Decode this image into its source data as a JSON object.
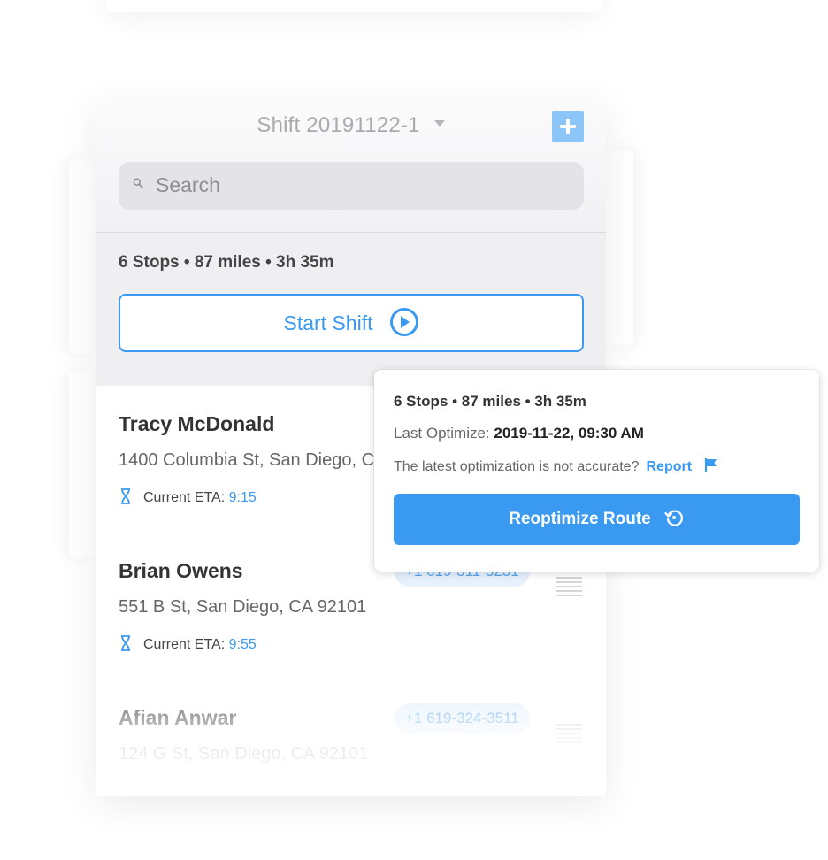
{
  "header": {
    "shift_title": "Shift 20191122-1",
    "search_placeholder": "Search"
  },
  "summary": {
    "text": "6 Stops • 87 miles • 3h 35m",
    "start_button": "Start Shift"
  },
  "stops": [
    {
      "name": "Tracy McDonald",
      "address": "1400 Columbia St, San Diego, C",
      "eta_label": "Current ETA:",
      "eta_value": "9:15"
    },
    {
      "name": "Brian Owens",
      "address": "551 B St, San Diego, CA 92101",
      "phone": "+1 619-311-3231",
      "eta_label": "Current ETA:",
      "eta_value": "9:55"
    },
    {
      "name": "Afian Anwar",
      "address": "124 G St, San Diego, CA 92101",
      "phone": "+1 619-324-3511"
    }
  ],
  "popover": {
    "summary": "6 Stops • 87 miles • 3h 35m",
    "last_optimize_label": "Last Optimize:",
    "last_optimize_value": "2019-11-22, 09:30 AM",
    "accuracy_question": "The latest optimization is not accurate?",
    "report_link": "Report",
    "reoptimize_button": "Reoptimize Route"
  },
  "colors": {
    "accent": "#3a99f1",
    "header_bg": "#f1f1f4",
    "pill_bg": "#e6f1fd"
  },
  "icons": {
    "add": "plus-icon",
    "search": "magnifier-icon",
    "start": "play-circle-icon",
    "eta": "hourglass-icon",
    "report": "flag-icon",
    "reoptimize": "refresh-icon",
    "drag": "drag-handle-icon"
  }
}
